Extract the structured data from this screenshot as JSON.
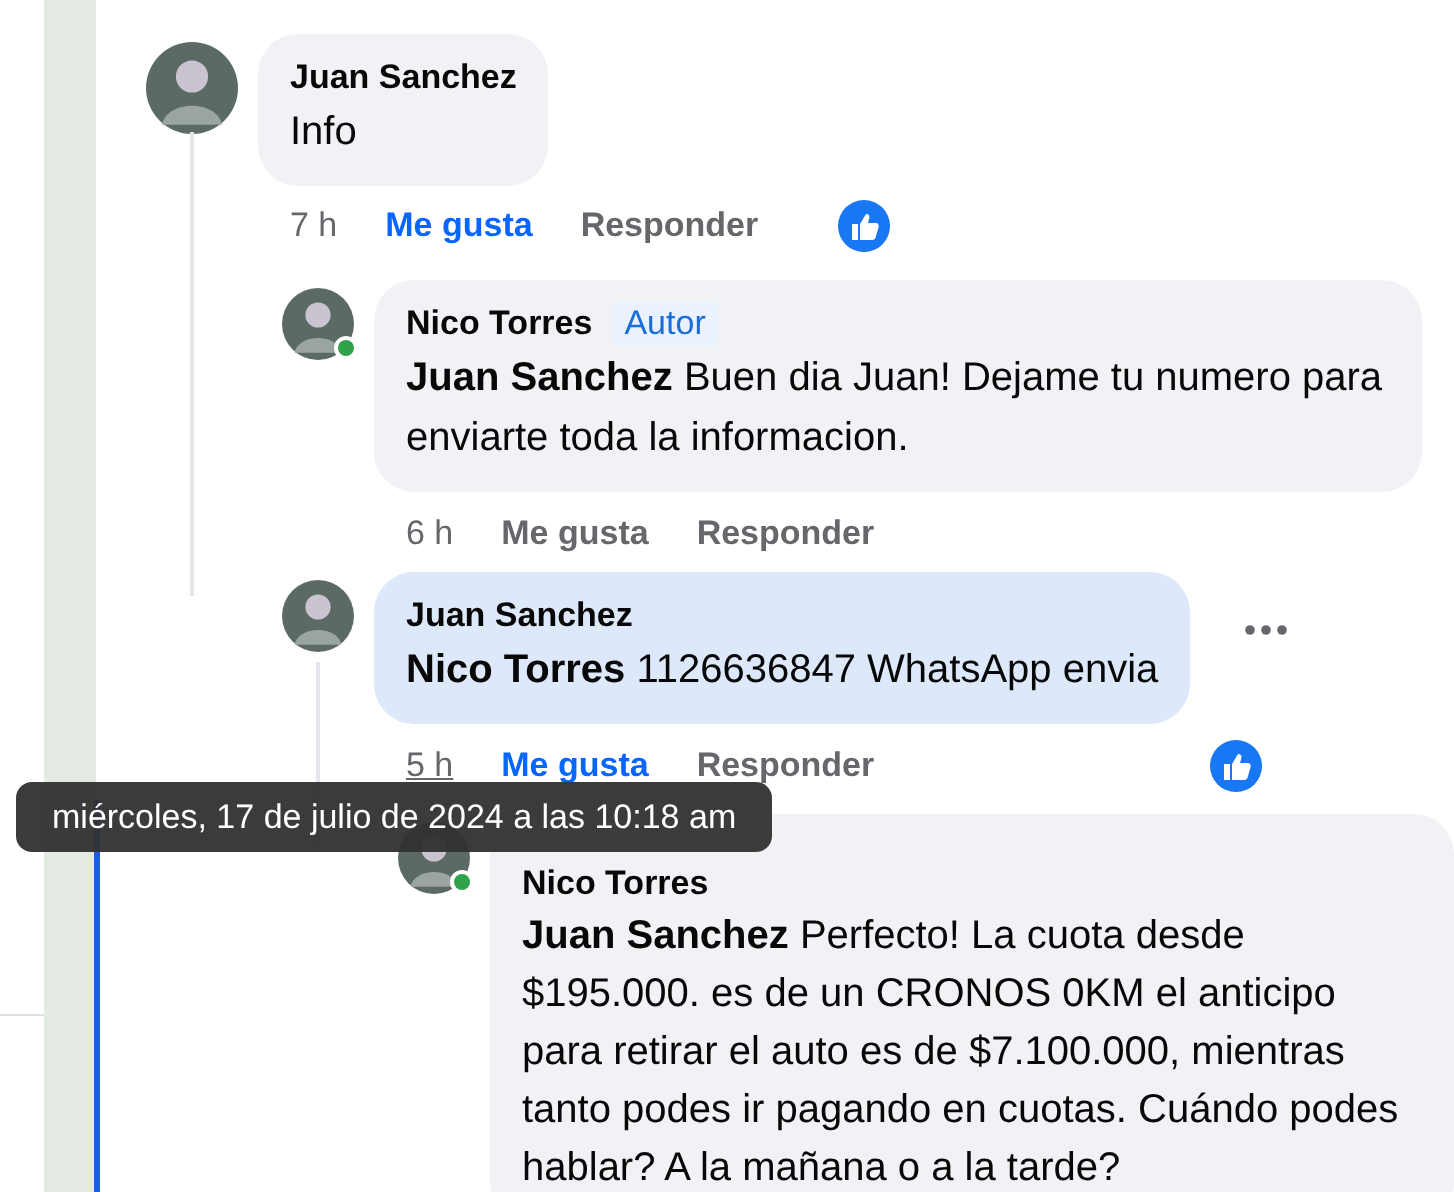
{
  "comments": [
    {
      "author": "Juan Sanchez",
      "text": "Info",
      "time": "7 h",
      "time_underlined": false,
      "like": "Me gusta",
      "liked": true,
      "reply": "Responder",
      "reaction": true,
      "online": false,
      "highlighted": false,
      "menu": false,
      "children": [
        {
          "author": "Nico Torres",
          "badge": "Autor",
          "text": "**Juan Sanchez** Buen dia Juan! Dejame tu numero para enviarte toda la informacion.",
          "time": "6 h",
          "time_underlined": false,
          "like": "Me gusta",
          "liked": false,
          "reply": "Responder",
          "reaction": false,
          "online": true,
          "highlighted": false,
          "menu": false
        },
        {
          "author": "Juan Sanchez",
          "text": "**Nico Torres** 1126636847 WhatsApp envia",
          "time": "5 h",
          "time_underlined": true,
          "like": "Me gusta",
          "liked": true,
          "reply": "Responder",
          "reaction": true,
          "online": false,
          "highlighted": true,
          "menu": true,
          "children": [
            {
              "author": "Nico Torres",
              "text": "**Juan Sanchez** Perfecto! La cuota desde $195.000. es de un CRONOS 0KM el anticipo para retirar el auto es de $7.100.000, mientras tanto podes ir pagando en cuotas. Cuándo podes hablar? A la mañana o a la tarde?",
              "online": true,
              "highlighted": false,
              "menu": false
            }
          ]
        }
      ]
    }
  ],
  "tooltip": {
    "text": "miércoles, 17 de julio de 2024 a las 10:18 am"
  }
}
